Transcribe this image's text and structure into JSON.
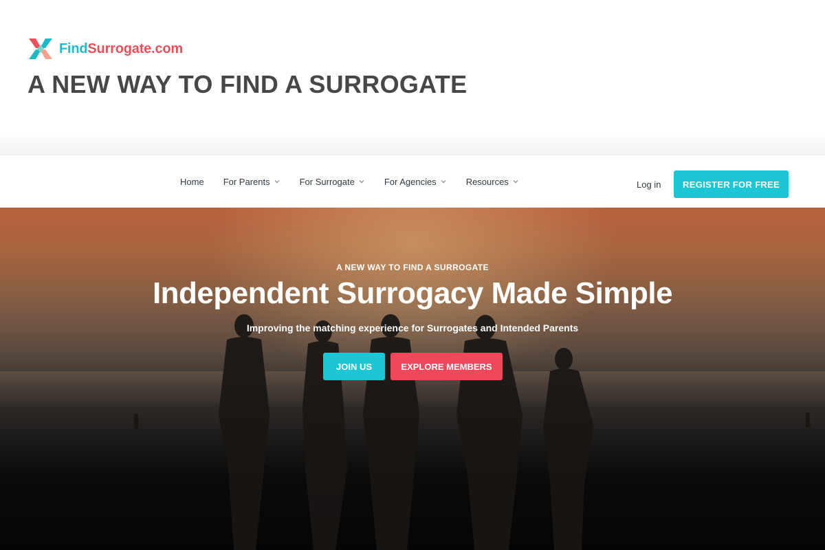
{
  "brand": {
    "name_part1": "Find",
    "name_part2": "Surrogate.com",
    "logo_icon": "x-cross-logo-icon",
    "colors": {
      "teal": "#1cc6d4",
      "coral": "#f0485a",
      "headline": "#474747"
    }
  },
  "headline": "A NEW WAY TO FIND A SURROGATE",
  "nav": {
    "items": [
      {
        "label": "Home",
        "has_dropdown": false
      },
      {
        "label": "For Parents",
        "has_dropdown": true
      },
      {
        "label": "For Surrogate",
        "has_dropdown": true
      },
      {
        "label": "For Agencies",
        "has_dropdown": true
      },
      {
        "label": "Resources",
        "has_dropdown": true
      }
    ],
    "login_label": "Log in",
    "register_label": "REGISTER FOR FREE"
  },
  "hero": {
    "kicker": "A NEW WAY TO FIND A SURROGATE",
    "title": "Independent Surrogacy Made Simple",
    "subtitle": "Improving the matching experience for Surrogates and Intended Parents",
    "join_label": "JOIN US",
    "explore_label": "EXPLORE MEMBERS"
  }
}
